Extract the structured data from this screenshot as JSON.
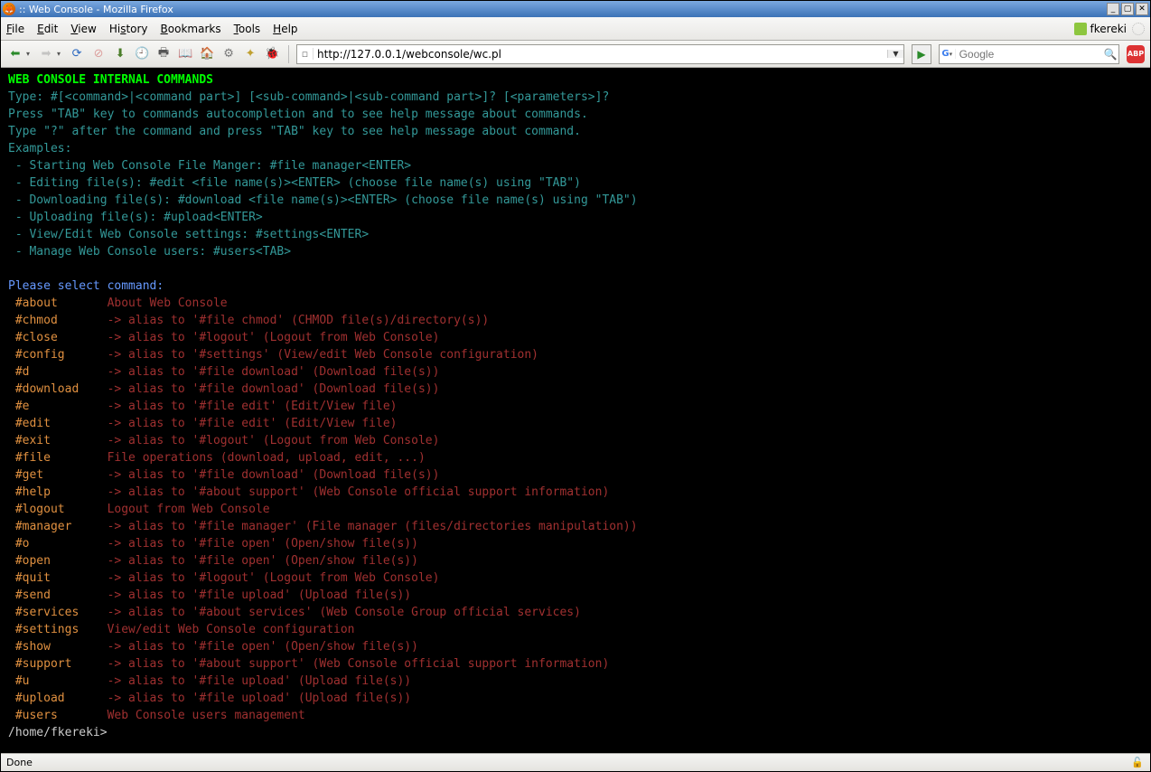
{
  "window": {
    "title": ":: Web Console - Mozilla Firefox"
  },
  "menu": {
    "items": [
      "File",
      "Edit",
      "View",
      "History",
      "Bookmarks",
      "Tools",
      "Help"
    ],
    "user": "fkereki"
  },
  "toolbar": {
    "url": "http://127.0.0.1/webconsole/wc.pl",
    "search_placeholder": "Google"
  },
  "terminal": {
    "header": "WEB CONSOLE INTERNAL COMMANDS",
    "help_lines": [
      "Type: #[<command>|<command part>] [<sub-command>|<sub-command part>]? [<parameters>]?",
      "Press \"TAB\" key to commands autocompletion and to see help message about commands.",
      "Type \"?\" after the command and press \"TAB\" key to see help message about command.",
      "Examples:",
      " - Starting Web Console File Manger: #file manager<ENTER>",
      " - Editing file(s): #edit <file name(s)><ENTER> (choose file name(s) using \"TAB\")",
      " - Downloading file(s): #download <file name(s)><ENTER> (choose file name(s) using \"TAB\")",
      " - Uploading file(s): #upload<ENTER>",
      " - View/Edit Web Console settings: #settings<ENTER>",
      " - Manage Web Console users: #users<TAB>"
    ],
    "select_prompt": "Please select command:",
    "commands": [
      {
        "k": "#about",
        "d": "About Web Console"
      },
      {
        "k": "#chmod",
        "d": "-> alias to '#file chmod' (CHMOD file(s)/directory(s))"
      },
      {
        "k": "#close",
        "d": "-> alias to '#logout' (Logout from Web Console)"
      },
      {
        "k": "#config",
        "d": "-> alias to '#settings' (View/edit Web Console configuration)"
      },
      {
        "k": "#d",
        "d": "-> alias to '#file download' (Download file(s))"
      },
      {
        "k": "#download",
        "d": "-> alias to '#file download' (Download file(s))"
      },
      {
        "k": "#e",
        "d": "-> alias to '#file edit' (Edit/View file)"
      },
      {
        "k": "#edit",
        "d": "-> alias to '#file edit' (Edit/View file)"
      },
      {
        "k": "#exit",
        "d": "-> alias to '#logout' (Logout from Web Console)"
      },
      {
        "k": "#file",
        "d": "File operations (download, upload, edit, ...)"
      },
      {
        "k": "#get",
        "d": "-> alias to '#file download' (Download file(s))"
      },
      {
        "k": "#help",
        "d": "-> alias to '#about support' (Web Console official support information)"
      },
      {
        "k": "#logout",
        "d": "Logout from Web Console"
      },
      {
        "k": "#manager",
        "d": "-> alias to '#file manager' (File manager (files/directories manipulation))"
      },
      {
        "k": "#o",
        "d": "-> alias to '#file open' (Open/show file(s))"
      },
      {
        "k": "#open",
        "d": "-> alias to '#file open' (Open/show file(s))"
      },
      {
        "k": "#quit",
        "d": "-> alias to '#logout' (Logout from Web Console)"
      },
      {
        "k": "#send",
        "d": "-> alias to '#file upload' (Upload file(s))"
      },
      {
        "k": "#services",
        "d": "-> alias to '#about services' (Web Console Group official services)"
      },
      {
        "k": "#settings",
        "d": "View/edit Web Console configuration"
      },
      {
        "k": "#show",
        "d": "-> alias to '#file open' (Open/show file(s))"
      },
      {
        "k": "#support",
        "d": "-> alias to '#about support' (Web Console official support information)"
      },
      {
        "k": "#u",
        "d": "-> alias to '#file upload' (Upload file(s))"
      },
      {
        "k": "#upload",
        "d": "-> alias to '#file upload' (Upload file(s))"
      },
      {
        "k": "#users",
        "d": "Web Console users management"
      }
    ],
    "prompt": "/home/fkereki>"
  },
  "statusbar": {
    "text": "Done"
  }
}
